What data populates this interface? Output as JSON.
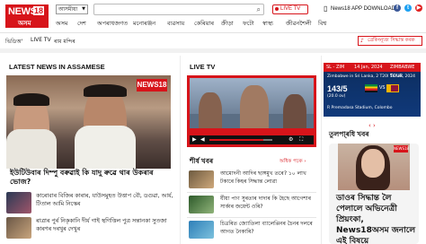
{
  "brand": {
    "logo_name": "NEWS",
    "logo_number": "18",
    "logo_lang": "অসম",
    "accent": "#d7141a"
  },
  "header": {
    "lang_select": "আসমীয়া",
    "search_icon": "search-icon",
    "live_tv": "LIVE TV",
    "app_download": "News18 APP DOWNLOAD",
    "social": [
      "facebook-icon",
      "twitter-icon",
      "youtube-icon"
    ]
  },
  "nav": {
    "items": [
      "অসম",
      "দেশ",
      "অপৰাধজগত",
      "মনোৰঞ্জন",
      "ব্যৱসায়",
      "কেৰিয়াৰ",
      "ক্রীড়া",
      "ফটো",
      "স্বাস্থ্য",
      "জীৱনশৈলী",
      "বিশ্ব"
    ]
  },
  "subnav": {
    "items": [
      "ভিডিঅ'",
      "LIVE TV",
      "ৰাম মন্দিৰ"
    ],
    "breaking": "ব্ৰেকিংন্যূজ সিদ্ধান্ত কৰক"
  },
  "latest": {
    "title": "LATEST NEWS IN ASSAMESE",
    "image_badge": "NEWS18",
    "headline": "ইউটিউবাৰ দিম্পু বৰুৱাই কি যাদু ৰুৱে থাৰ উকৰাৰ ভোজ?",
    "items": [
      {
        "text": "কাৰোবাৰ বিজিৰ কাৰাৰ, যাউসমুহত উত্তাপ বৌ, ডগুৱা, আৰ্য, টিতাল আমি নিস্কেৰ"
      },
      {
        "text": "ৰাত্ৰাৰ পুৰ্ৰ নিকৃকানি দীৰ্য গাই স্থগিত্তিল পুত্ৰ সন্তানকা সুতজা কাৰণৰ দৰখুৰ দেখুৰ"
      }
    ]
  },
  "live_tv": {
    "title": "LIVE TV"
  },
  "shirsh": {
    "title": "শীৰ্ষ খবৰ",
    "more": "অধিক পঢ়ক ›",
    "items": [
      {
        "text": "আমোদনী আদিৰ ছাঙ্গমুখ তৰে? ১০ লাখ টকাৰে কিহৰ সিদ্ধান্ত লোৱা"
      },
      {
        "text": "ৰ্যীয়া পাণ সুৰতাৰ দাদাৰ কি হৈছে আগেশাৰ সাৰ্কাৰ জয়েন্ট ওৰি?"
      },
      {
        "text": "চিত্ৰৰিত জ্যোতিলা ব্যালেপ্পিনৰ চৈনৰ দলৰে আগত নৈকাৰি?"
      }
    ]
  },
  "cricket": {
    "header_left": "SL - ZIM",
    "header_mid": "14 Jan, 2024",
    "header_right": "ZIMBABWE TOUR",
    "match": "Zimbabwe in Sri Lanka, 2 T20I Series, 2024",
    "score": "143/5",
    "overs": "(20.0 ov)",
    "vs": "VS",
    "venue": "R Premadasa Stadium, Colombo"
  },
  "pager": "‹ ›",
  "trending": {
    "title": "তুলপা্ৰধি খবৰ",
    "badge": "NEWS18",
    "headline": "ডাওৰ সিদ্ধান্ত লৈ পেলালে অভিনেত্ৰী প্ৰিয়ংকা, News18অসম জনালে এই বিষয়ে"
  }
}
